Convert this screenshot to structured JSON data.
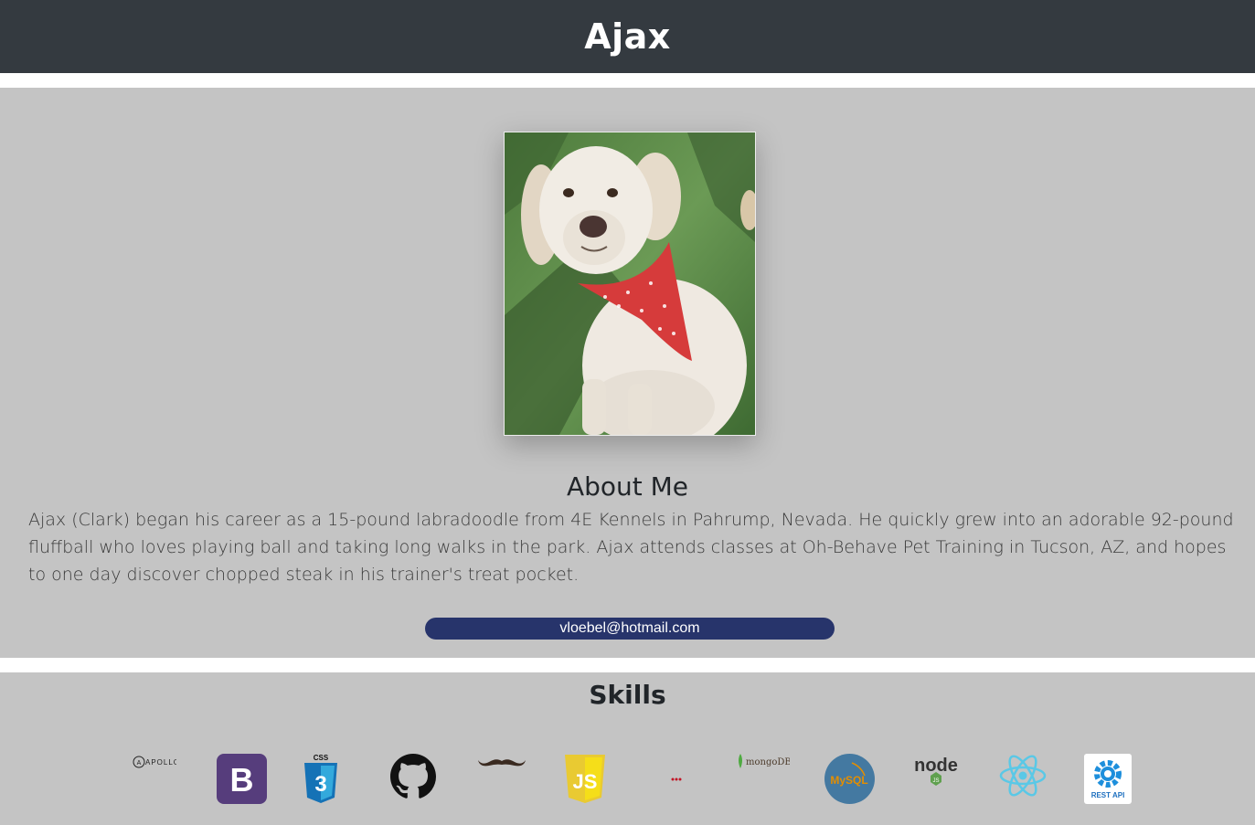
{
  "header": {
    "title": "Ajax"
  },
  "about": {
    "photo_alt": "Ajax the labradoodle wearing a red bandana",
    "heading": "About Me",
    "bio": "Ajax (Clark) began his career as a 15-pound labradoodle from 4E Kennels in Pahrump, Nevada. He quickly grew into an adorable 92-pound fluffball who loves playing ball and taking long walks in the park. Ajax attends classes at Oh-Behave Pet Training in Tucson, AZ, and hopes to one day discover chopped steak in his trainer's treat pocket.",
    "email": "vloebel@hotmail.com"
  },
  "skills": {
    "heading": "Skills",
    "items": [
      {
        "icon": "apollo-icon",
        "label": "APOLLO"
      },
      {
        "icon": "bootstrap-icon",
        "label": "B"
      },
      {
        "icon": "css3-icon",
        "label": "CSS"
      },
      {
        "icon": "github-icon"
      },
      {
        "icon": "handlebars-icon"
      },
      {
        "icon": "javascript-icon",
        "label": "JS"
      },
      {
        "icon": "jest-icon"
      },
      {
        "icon": "mongodb-icon",
        "label": "mongoDB"
      },
      {
        "icon": "mysql-icon",
        "label": "MySQL"
      },
      {
        "icon": "nodejs-icon",
        "label": "node"
      },
      {
        "icon": "react-icon"
      },
      {
        "icon": "rest-api-icon",
        "label": "REST API"
      }
    ]
  },
  "colors": {
    "header_bg": "#343a40",
    "section_bg": "#c4c4c4",
    "email_button_bg": "#27346b"
  }
}
